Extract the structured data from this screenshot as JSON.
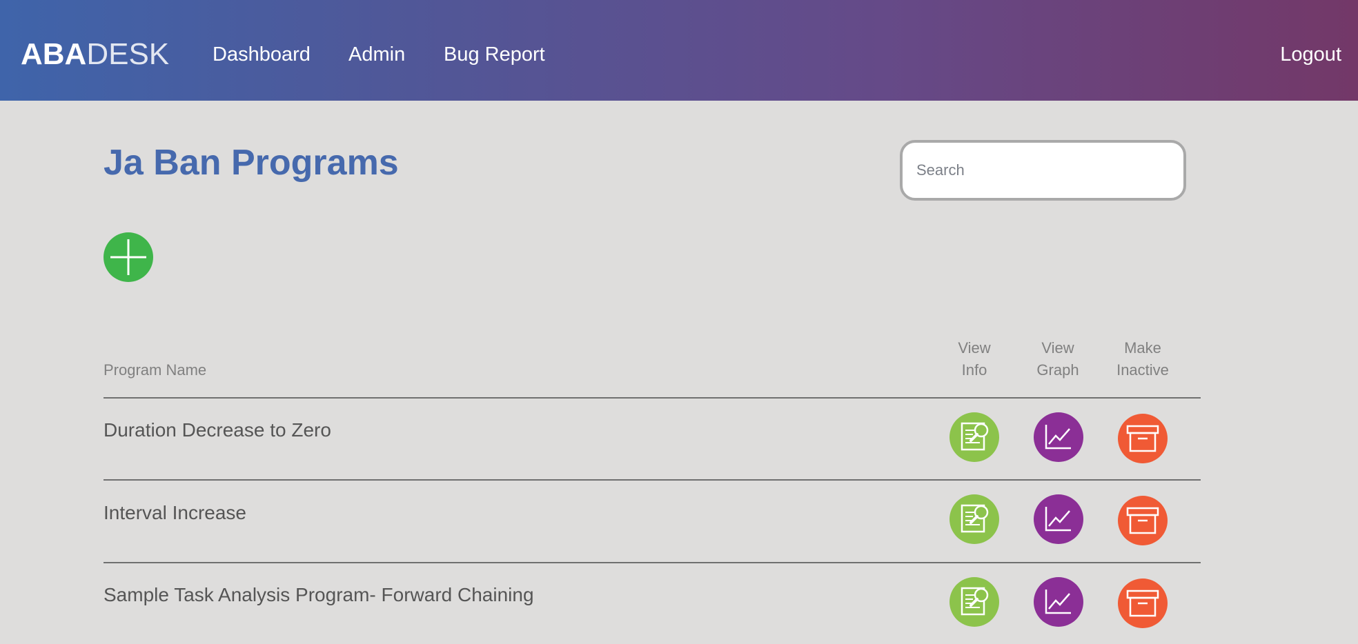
{
  "brand": {
    "part1": "ABA",
    "part2": "DESK"
  },
  "nav": {
    "dashboard": "Dashboard",
    "admin": "Admin",
    "bug_report": "Bug Report",
    "logout": "Logout"
  },
  "page": {
    "title": "Ja Ban Programs"
  },
  "search": {
    "placeholder": "Search",
    "value": ""
  },
  "table": {
    "headers": {
      "name": "Program Name",
      "view_info": [
        "View",
        "Info"
      ],
      "view_graph": [
        "View",
        "Graph"
      ],
      "make_inactive": [
        "Make",
        "Inactive"
      ]
    },
    "rows": [
      {
        "name": "Duration Decrease to Zero"
      },
      {
        "name": "Interval Increase"
      },
      {
        "name": "Sample Task Analysis Program- Forward Chaining"
      }
    ]
  },
  "colors": {
    "nav_gradient_start": "#3f64aa",
    "nav_gradient_end": "#733868",
    "title": "#4669ad",
    "add": "#3fb54a",
    "view_info": "#8cc34b",
    "view_graph": "#8b2f96",
    "make_inactive": "#f05a35"
  },
  "icons": {
    "add": "plus-icon",
    "view_info": "document-search-icon",
    "view_graph": "line-chart-icon",
    "make_inactive": "archive-box-icon"
  }
}
